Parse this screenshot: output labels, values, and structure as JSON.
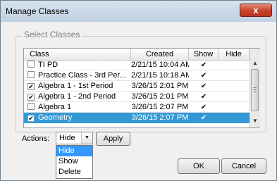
{
  "window": {
    "title": "Manage Classes",
    "close_glyph": "x"
  },
  "group": {
    "title": "Select Classes"
  },
  "table": {
    "columns": [
      "Class",
      "Created",
      "Show",
      "Hide"
    ],
    "rows": [
      {
        "name": "TI PD",
        "created": "2/21/15 10:04 AM",
        "checked": false,
        "show": "✔",
        "hide": "",
        "selected": false
      },
      {
        "name": "Practice Class - 3rd Per...",
        "created": "2/21/15 10:18 AM",
        "checked": false,
        "show": "✔",
        "hide": "",
        "selected": false
      },
      {
        "name": "Algebra 1 - 1st Period",
        "created": "3/26/15 2:01 PM",
        "checked": true,
        "show": "✔",
        "hide": "",
        "selected": false
      },
      {
        "name": "Algebra 1 - 2nd Period",
        "created": "3/26/15 2:01 PM",
        "checked": true,
        "show": "✔",
        "hide": "",
        "selected": false
      },
      {
        "name": "Algebra 1",
        "created": "3/26/15 2:07 PM",
        "checked": false,
        "show": "✔",
        "hide": "",
        "selected": false
      },
      {
        "name": "Geometry",
        "created": "3/26/15 2:07 PM",
        "checked": true,
        "show": "✔",
        "hide": "",
        "selected": true
      }
    ],
    "check_glyph": "✔"
  },
  "actions": {
    "label": "Actions:",
    "selected": "Hide",
    "options": [
      "Hide",
      "Show",
      "Delete"
    ],
    "apply_label": "Apply"
  },
  "buttons": {
    "ok": "OK",
    "cancel": "Cancel"
  },
  "colors": {
    "selection": "#3399d6",
    "close_button": "#c7422b"
  }
}
